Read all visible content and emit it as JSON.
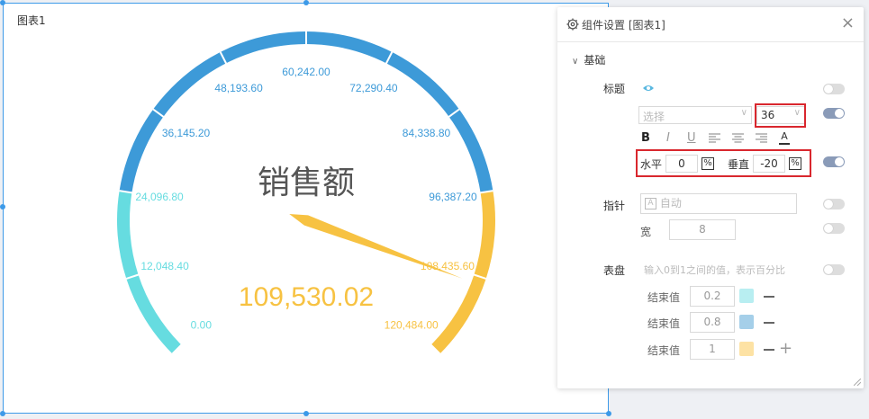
{
  "chart_title": "图表1",
  "chart_data": {
    "type": "gauge",
    "title": "销售额",
    "value_text": "109,530.02",
    "value": 109530.02,
    "min": 0,
    "max": 120484.0,
    "tick_labels": [
      "0.00",
      "12,048.40",
      "24,096.80",
      "36,145.20",
      "48,193.60",
      "60,242.00",
      "72,290.40",
      "84,338.80",
      "96,387.20",
      "108,435.60",
      "120,484.00"
    ],
    "bands": [
      {
        "end": 0.2,
        "color": "#66dce0"
      },
      {
        "end": 0.8,
        "color": "#3d9ad8"
      },
      {
        "end": 1,
        "color": "#f7c242"
      }
    ]
  },
  "panel": {
    "title": "组件设置 [图表1]",
    "close": "×",
    "section": "基础",
    "title_row": {
      "label": "标题",
      "font_placeholder": "选择",
      "size": "36",
      "format_bold": "B",
      "format_italic": "I",
      "format_underline": "U",
      "format_color": "A",
      "horizontal_label": "水平",
      "horizontal_value": "0",
      "vertical_label": "垂直",
      "vertical_value": "-20",
      "pct": "%"
    },
    "pointer_row": {
      "label": "指针",
      "auto_label": "自动",
      "auto_icon": "A",
      "width_label": "宽",
      "width_value": "8"
    },
    "dial_row": {
      "label": "表盘",
      "hint": "输入0到1之间的值，表示百分比",
      "end_label": "结束值",
      "ends": [
        "0.2",
        "0.8",
        "1"
      ],
      "swatch_colors": [
        "#b8eef1",
        "#a5cfe9",
        "#fde2a4"
      ]
    }
  }
}
